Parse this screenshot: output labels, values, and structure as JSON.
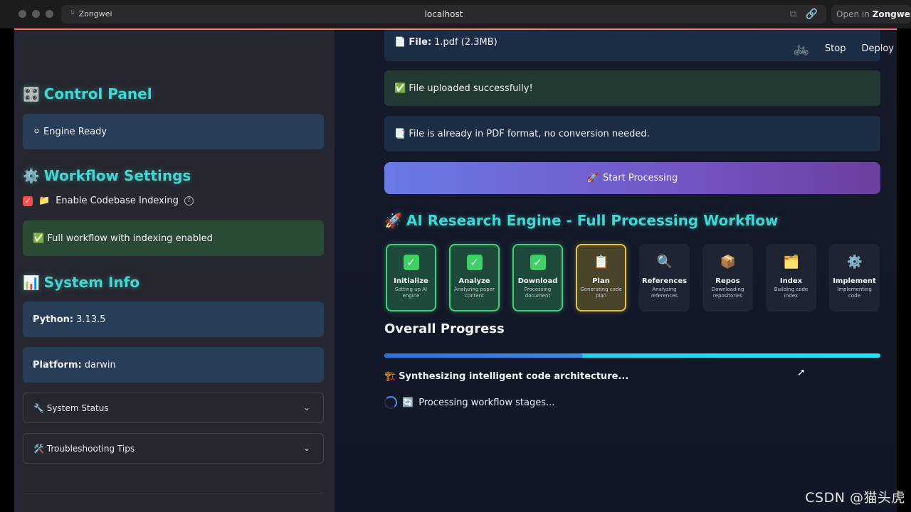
{
  "browser": {
    "profile": "Zongwei",
    "address": "localhost",
    "open_in_prefix": "Open in",
    "open_in_target": "Zongwei"
  },
  "sidebar": {
    "control_panel": {
      "icon": "🎛️",
      "title": "Control Panel"
    },
    "engine_status": {
      "icon": "⚪",
      "text": "Engine Ready"
    },
    "workflow_settings": {
      "icon": "⚙️",
      "title": "Workflow Settings"
    },
    "indexing_checkbox": {
      "checked": true,
      "icon": "📁",
      "label": "Enable Codebase Indexing",
      "help": "?"
    },
    "workflow_notice": {
      "icon": "✅",
      "text": "Full workflow with indexing enabled"
    },
    "system_info": {
      "icon": "📊",
      "title": "System Info"
    },
    "python": {
      "label": "Python:",
      "value": "3.13.5"
    },
    "platform": {
      "label": "Platform:",
      "value": "darwin"
    },
    "expanders": [
      {
        "icon": "🔧",
        "label": "System Status"
      },
      {
        "icon": "🛠️",
        "label": "Troubleshooting Tips"
      }
    ]
  },
  "main": {
    "top_actions": {
      "stop": "Stop",
      "deploy": "Deploy"
    },
    "file_alert": {
      "icon": "📄",
      "label": "File:",
      "value": "1.pdf (2.3MB)"
    },
    "upload_alert": {
      "icon": "✅",
      "text": "File uploaded successfully!"
    },
    "format_alert": {
      "icon": "📑",
      "text": "File is already in PDF format, no conversion needed."
    },
    "start_button": {
      "icon": "🚀",
      "label": "Start Processing"
    },
    "workflow_title": {
      "icon": "🚀",
      "text": "AI Research Engine - Full Processing Workflow"
    },
    "stages": [
      {
        "name": "Initialize",
        "desc": "Setting up AI engine",
        "icon": "✓",
        "state": "done"
      },
      {
        "name": "Analyze",
        "desc": "Analyzing paper content",
        "icon": "✓",
        "state": "done"
      },
      {
        "name": "Download",
        "desc": "Processing document",
        "icon": "✓",
        "state": "done"
      },
      {
        "name": "Plan",
        "desc": "Generating code plan",
        "icon": "📋",
        "state": "active"
      },
      {
        "name": "References",
        "desc": "Analyzing references",
        "icon": "🔍",
        "state": "pending"
      },
      {
        "name": "Repos",
        "desc": "Downloading repositories",
        "icon": "📦",
        "state": "pending"
      },
      {
        "name": "Index",
        "desc": "Building code index",
        "icon": "🗂️",
        "state": "pending"
      },
      {
        "name": "Implement",
        "desc": "Implementing code",
        "icon": "⚙️",
        "state": "pending"
      }
    ],
    "progress_title": "Overall Progress",
    "progress_fraction": 0.4,
    "status_text": {
      "icon": "🏗️",
      "text": "Synthesizing intelligent code architecture..."
    },
    "spinner_text": {
      "icon": "🔄",
      "text": "Processing workflow stages..."
    }
  },
  "watermark": "CSDN @猫头虎"
}
